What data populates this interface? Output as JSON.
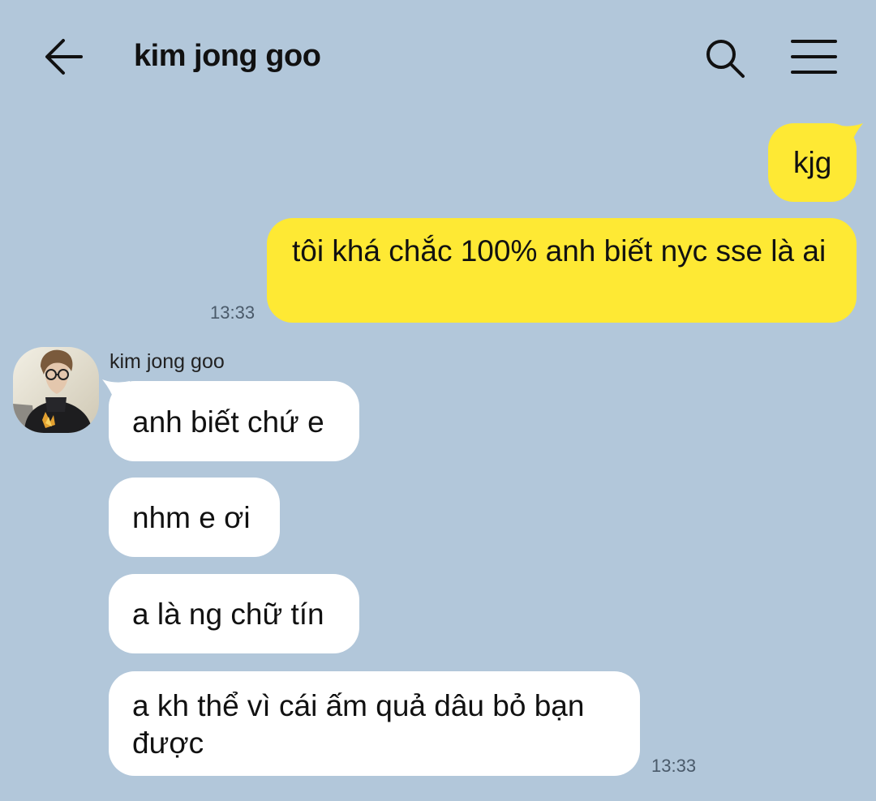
{
  "header": {
    "title": "kim jong goo",
    "back_icon": "back-arrow-icon",
    "search_icon": "search-icon",
    "menu_icon": "hamburger-menu-icon"
  },
  "colors": {
    "background": "#b2c7da",
    "my_bubble": "#fee934",
    "their_bubble": "#ffffff"
  },
  "outgoing": {
    "messages": [
      {
        "text": "kjg"
      },
      {
        "text": "tôi khá chắc 100% anh biết nyc sse là ai"
      }
    ],
    "time": "13:33"
  },
  "incoming": {
    "sender": "kim jong goo",
    "messages": [
      {
        "text": "anh biết chứ e"
      },
      {
        "text": "nhm e ơi"
      },
      {
        "text": "a là ng chữ tín"
      },
      {
        "text": "a kh thể vì cái ấm quả dâu bỏ bạn được"
      }
    ],
    "time": "13:33"
  }
}
